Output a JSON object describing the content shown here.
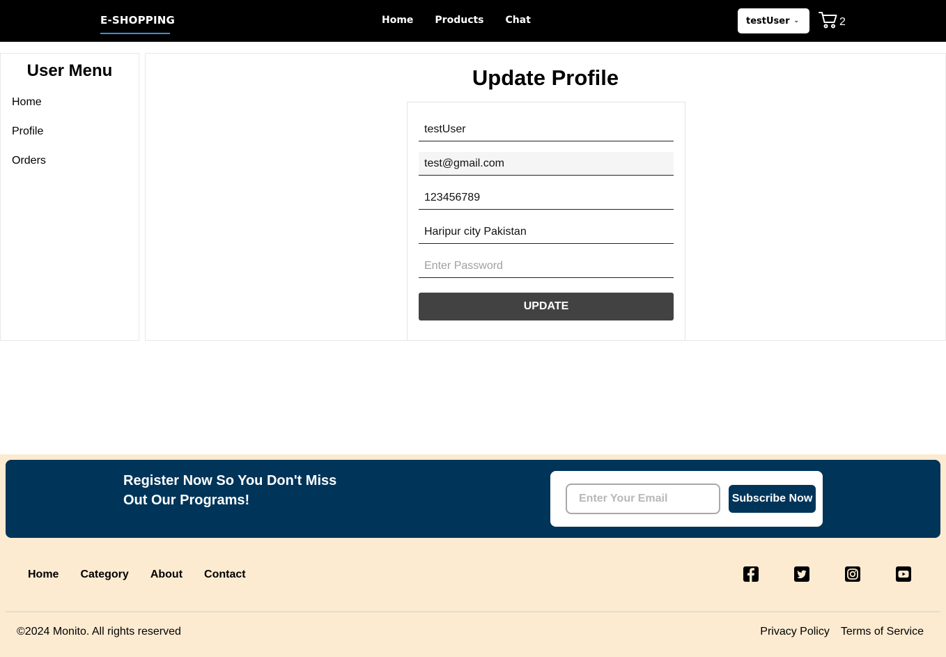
{
  "navbar": {
    "brand": "E-SHOPPING",
    "links": [
      "Home",
      "Products",
      "Chat"
    ],
    "user_label": "testUser",
    "cart_count": "2"
  },
  "sidebar": {
    "title": "User Menu",
    "items": [
      "Home",
      "Profile",
      "Orders"
    ]
  },
  "main": {
    "title": "Update Profile",
    "form": {
      "name_value": "testUser",
      "email_value": "test@gmail.com",
      "phone_value": "123456789",
      "address_value": "Haripur city Pakistan",
      "password_placeholder": "Enter Password",
      "update_label": "UPDATE"
    }
  },
  "footer": {
    "banner_text": "Register Now So You Don't Miss Out Our Programs!",
    "email_placeholder": "Enter Your Email",
    "subscribe_label": "Subscribe Now",
    "links": [
      "Home",
      "Category",
      "About",
      "Contact"
    ],
    "social_icons": [
      "facebook-icon",
      "twitter-icon",
      "instagram-icon",
      "youtube-icon"
    ],
    "copyright": "©2024 Monito. All rights reserved",
    "legal": [
      "Privacy Policy",
      "Terms of Service"
    ]
  },
  "colors": {
    "navbar_bg": "#000000",
    "banner_bg": "#003459",
    "footer_bg": "#fcebd1",
    "update_button": "#424242",
    "brand_underline": "#3b8fd9"
  }
}
